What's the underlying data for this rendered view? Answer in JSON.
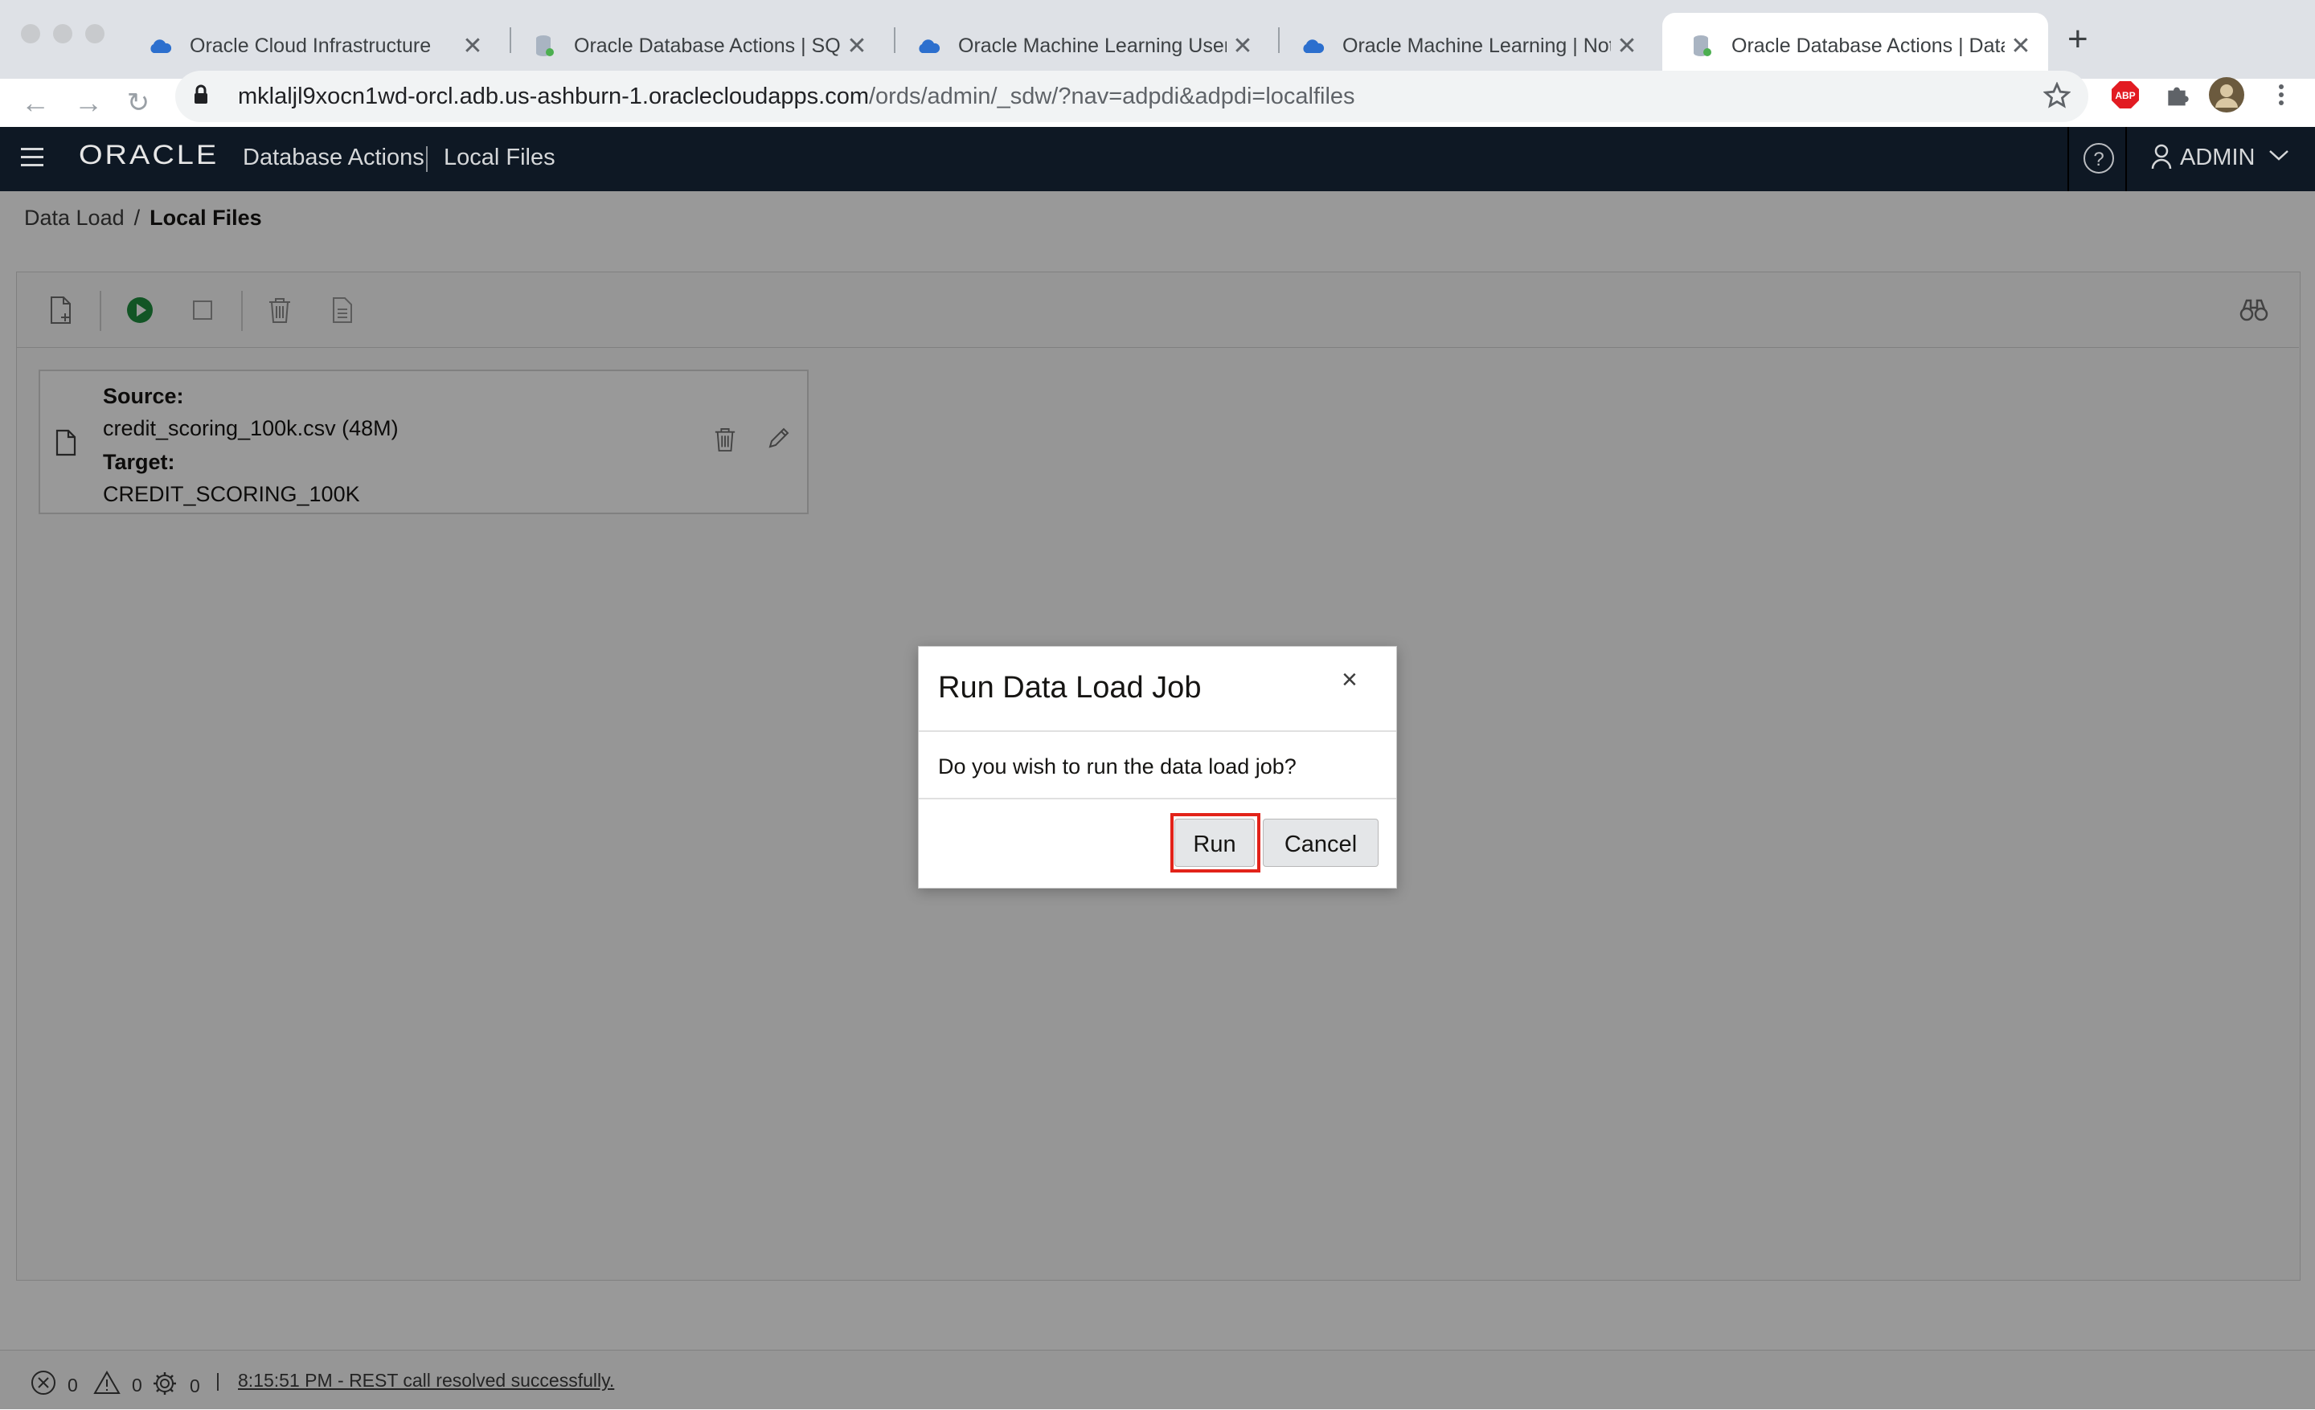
{
  "browser": {
    "tabs": [
      {
        "title": "Oracle Cloud Infrastructure",
        "icon": "cloud-icon"
      },
      {
        "title": "Oracle Database Actions | SQL",
        "icon": "database-icon"
      },
      {
        "title": "Oracle Machine Learning User",
        "icon": "cloud-icon"
      },
      {
        "title": "Oracle Machine Learning | Note",
        "icon": "cloud-icon"
      },
      {
        "title": "Oracle Database Actions | Data",
        "icon": "database-icon"
      }
    ],
    "url_host": "mklaljl9xocn1wd-orcl.adb.us-ashburn-1.oraclecloudapps.com",
    "url_path": "/ords/admin/_sdw/?nav=adpdi&adpdi=localfiles",
    "ext_badge": "ABP"
  },
  "app": {
    "brand": "ORACLE",
    "name": "Database Actions",
    "page": "Local Files",
    "user": "ADMIN",
    "help": "?"
  },
  "breadcrumb": {
    "parent": "Data Load",
    "separator": "/",
    "current": "Local Files"
  },
  "load_item": {
    "source_label": "Source:",
    "source_value": "credit_scoring_100k.csv (48M)",
    "target_label": "Target:",
    "target_value": "CREDIT_SCORING_100K"
  },
  "status": {
    "errors": "0",
    "warnings": "0",
    "jobs": "0",
    "separator": "|",
    "message": "8:15:51 PM - REST call resolved successfully."
  },
  "dialog": {
    "title": "Run Data Load Job",
    "close": "×",
    "message": "Do you wish to run the data load job?",
    "run_label": "Run",
    "cancel_label": "Cancel"
  },
  "colors": {
    "header_bg": "#0e1824",
    "run_icon": "#1e8e3e",
    "highlight": "#e2231a"
  }
}
